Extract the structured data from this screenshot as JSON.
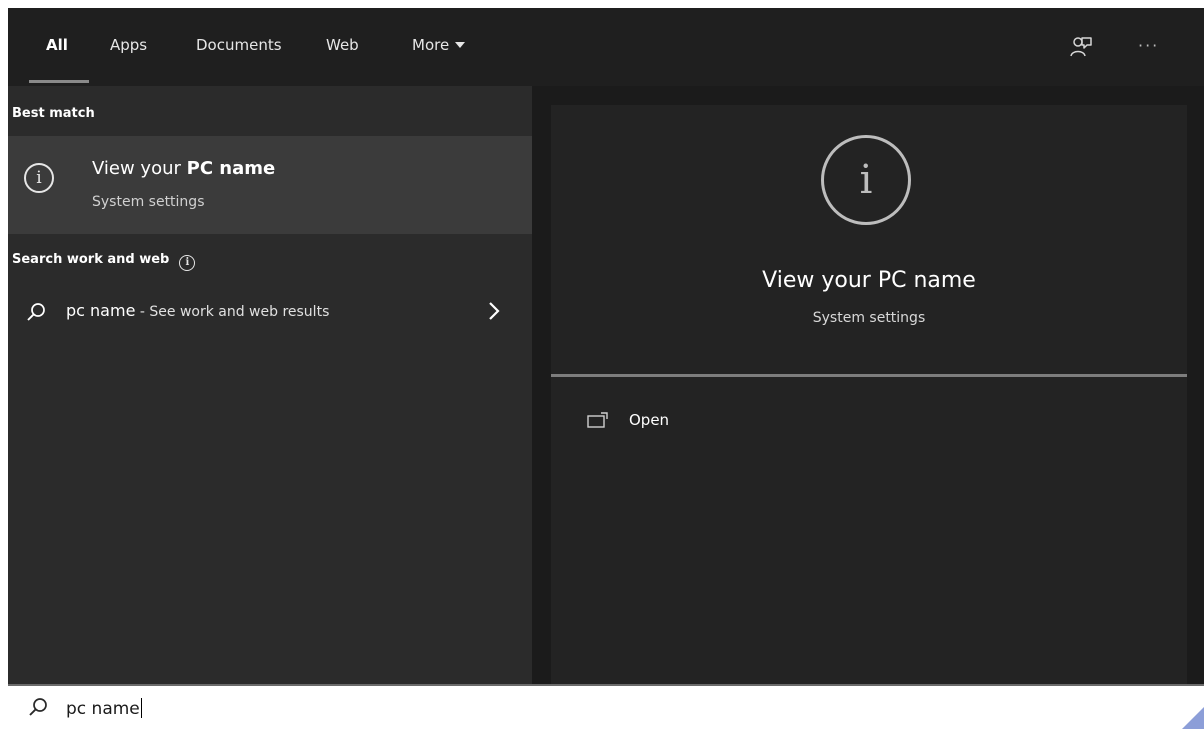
{
  "tabs": [
    {
      "label": "All",
      "active": true
    },
    {
      "label": "Apps",
      "active": false
    },
    {
      "label": "Documents",
      "active": false
    },
    {
      "label": "Web",
      "active": false
    },
    {
      "label": "More",
      "active": false
    }
  ],
  "header_icons": {
    "feedback": "feedback-icon",
    "more_options": "···"
  },
  "left": {
    "best_match_header": "Best match",
    "best_match": {
      "title_prefix": "View your ",
      "title_bold": "PC name",
      "subtitle": "System settings",
      "icon": "info-icon"
    },
    "web_header": "Search work and web",
    "web_result": {
      "query": "pc name",
      "suffix": " - See work and web results",
      "icon": "search-icon"
    }
  },
  "right": {
    "icon": "info-icon",
    "title": "View your PC name",
    "subtitle": "System settings",
    "actions": [
      {
        "label": "Open",
        "icon": "open-window-icon"
      }
    ]
  },
  "search": {
    "value": "pc name",
    "icon": "search-icon"
  },
  "colors": {
    "panel_dark": "#1f1f1f",
    "left_panel": "#2b2b2b",
    "highlight": "#3b3b3b",
    "preview_card": "#232323",
    "accent": "#8c9ed8"
  }
}
